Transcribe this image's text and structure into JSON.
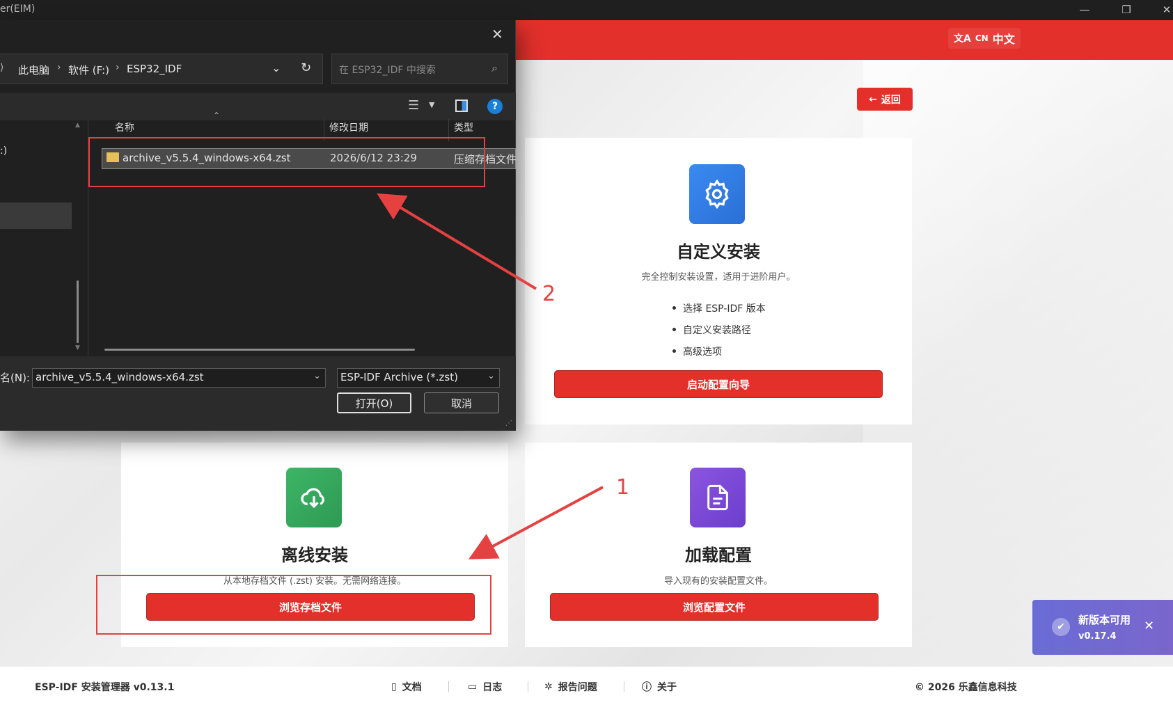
{
  "window": {
    "title": "er(EIM)"
  },
  "header": {
    "lang_icon": "translate-icon",
    "lang_code": "CN",
    "lang_label": "中文"
  },
  "back_button": {
    "label": "返回"
  },
  "cards": {
    "custom": {
      "title": "自定义安装",
      "desc": "完全控制安装设置，适用于进阶用户。",
      "features": [
        "选择 ESP-IDF 版本",
        "自定义安装路径",
        "高级选项"
      ],
      "button": "启动配置向导",
      "icon_color": "#2f7de0"
    },
    "offline": {
      "title": "离线安装",
      "desc": "从本地存档文件 (.zst) 安装。无需网络连接。",
      "button": "浏览存档文件",
      "icon_color": "#36a85a"
    },
    "load": {
      "title": "加载配置",
      "desc": "导入现有的安装配置文件。",
      "button": "浏览配置文件",
      "icon_color": "#7a45d6"
    }
  },
  "footer": {
    "version": "ESP-IDF 安装管理器 v0.13.1",
    "links": [
      "文档",
      "日志",
      "报告问题",
      "关于"
    ],
    "copyright": "© 2026 乐鑫信息科技"
  },
  "toast": {
    "title": "新版本可用",
    "version": "v0.17.4"
  },
  "dialog": {
    "breadcrumb": [
      "此电脑",
      "软件 (F:)",
      "ESP32_IDF"
    ],
    "search_placeholder": "在 ESP32_IDF 中搜索",
    "columns": [
      "名称",
      "修改日期",
      "类型"
    ],
    "files": [
      {
        "name": "archive_v5.5.4_windows-x64.zst",
        "modified": "2026/6/12 23:29",
        "type": "压缩存档文件"
      }
    ],
    "nav_partial": ":)",
    "filename_label": "名(N):",
    "filename_value": "archive_v5.5.4_windows-x64.zst",
    "filetype_value": "ESP-IDF Archive (*.zst)",
    "open_button": "打开(O)",
    "cancel_button": "取消"
  },
  "annotations": {
    "step1": "1",
    "step2": "2",
    "color": "#e64141"
  }
}
